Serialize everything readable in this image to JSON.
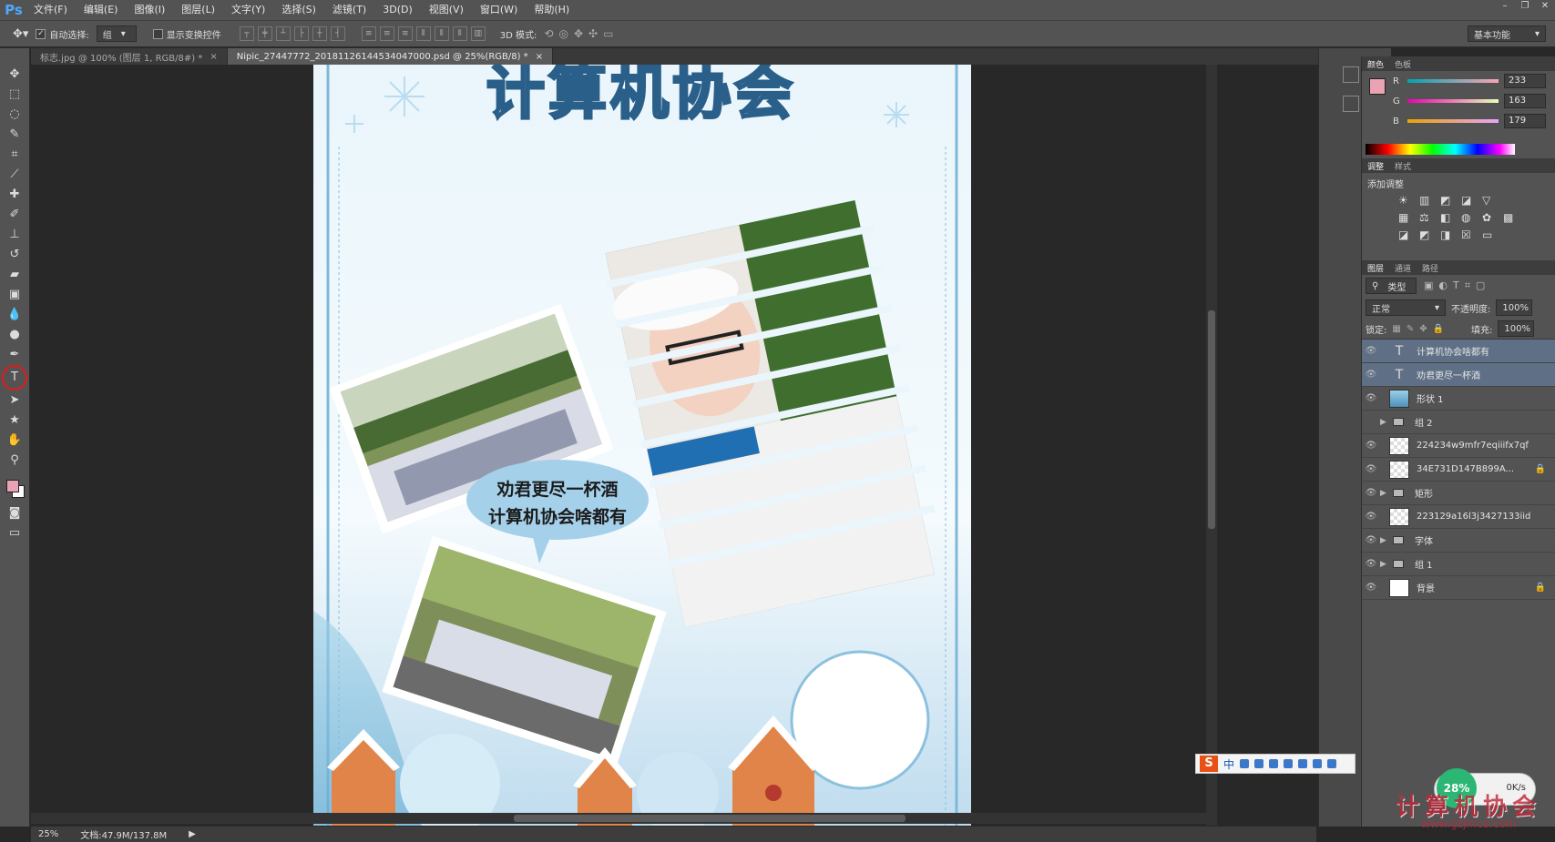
{
  "app": {
    "logo": "Ps"
  },
  "menu": [
    "文件(F)",
    "编辑(E)",
    "图像(I)",
    "图层(L)",
    "文字(Y)",
    "选择(S)",
    "滤镜(T)",
    "3D(D)",
    "视图(V)",
    "窗口(W)",
    "帮助(H)"
  ],
  "window_controls": [
    "–",
    "❐",
    "✕"
  ],
  "options": {
    "auto_select_label": "自动选择:",
    "auto_select_value": "组",
    "show_transform_label": "显示变换控件",
    "mode3d_label": "3D 模式:",
    "workspace": "基本功能"
  },
  "tabs": [
    {
      "label": "标志.jpg @ 100% (图层 1, RGB/8#) *",
      "active": false
    },
    {
      "label": "Nipic_27447772_20181126144534047000.psd @ 25%(RGB/8) *",
      "active": true
    }
  ],
  "poster": {
    "title": "计算机协会",
    "bubble_line1": "劝君更尽一杯酒",
    "bubble_line2": "计算机协会啥都有"
  },
  "color_panel": {
    "tabs": [
      "颜色",
      "色板"
    ],
    "foreground": "#e9a3b3",
    "channels": [
      {
        "name": "R",
        "value": "233"
      },
      {
        "name": "G",
        "value": "163"
      },
      {
        "name": "B",
        "value": "179"
      }
    ]
  },
  "adjust_panel": {
    "tabs": [
      "调整",
      "样式"
    ],
    "title": "添加调整"
  },
  "layers_panel": {
    "tabs": [
      "图层",
      "通道",
      "路径"
    ],
    "filter": "类型",
    "blend_mode": "正常",
    "opacity_label": "不透明度:",
    "opacity": "100%",
    "lock_label": "锁定:",
    "fill_label": "填充:",
    "fill": "100%",
    "layers": [
      {
        "name": "计算机协会啥都有",
        "kind": "text",
        "selected": true,
        "visible": true
      },
      {
        "name": "劝君更尽一杯酒",
        "kind": "text",
        "selected": true,
        "visible": true
      },
      {
        "name": "形状 1",
        "kind": "shape",
        "selected": false,
        "visible": true
      },
      {
        "name": "组 2",
        "kind": "group",
        "selected": false,
        "visible": false
      },
      {
        "name": "224234w9mfr7eqiiifx7qf",
        "kind": "image",
        "selected": false,
        "visible": true
      },
      {
        "name": "34E731D147B899A...",
        "kind": "image",
        "selected": false,
        "visible": true,
        "locked": true
      },
      {
        "name": "矩形",
        "kind": "group",
        "selected": false,
        "visible": true
      },
      {
        "name": "223129a16l3j3427133iid",
        "kind": "image",
        "selected": false,
        "visible": true
      },
      {
        "name": "字体",
        "kind": "group",
        "selected": false,
        "visible": true
      },
      {
        "name": "组 1",
        "kind": "group",
        "selected": false,
        "visible": true
      },
      {
        "name": "背景",
        "kind": "background",
        "selected": false,
        "visible": true,
        "locked": true
      }
    ]
  },
  "status": {
    "zoom": "25%",
    "doc_size": "文档:47.9M/137.8M"
  },
  "ime": {
    "logo": "S",
    "lang": "中"
  },
  "tray": {
    "percent": "28%",
    "speed": "0K/s"
  },
  "watermark": "计算机协会",
  "watermark_url": "www.gzjmca.com"
}
